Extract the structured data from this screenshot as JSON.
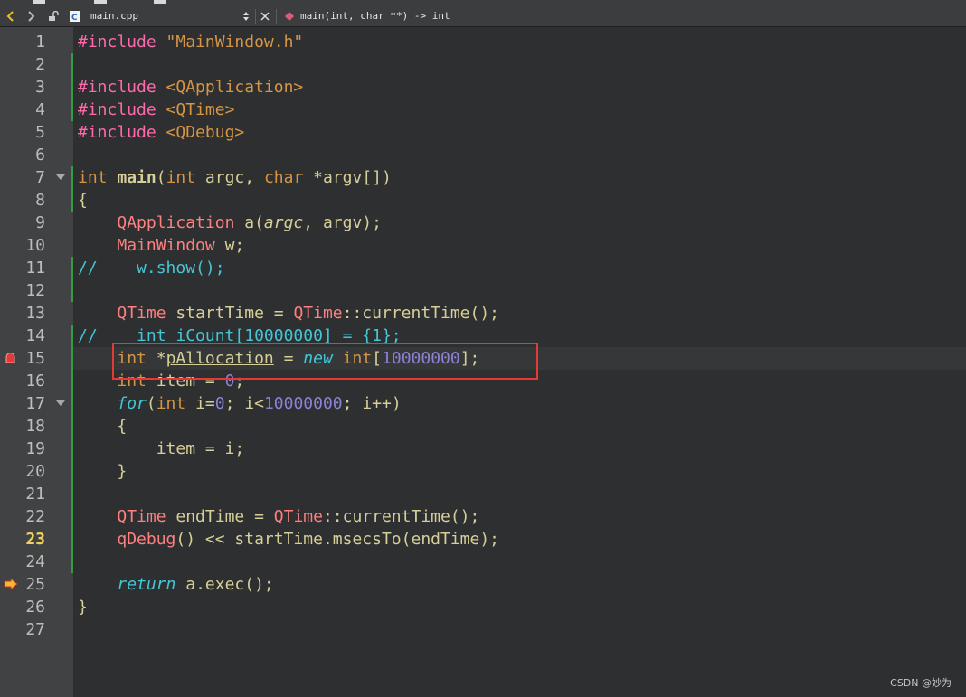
{
  "toolbar": {
    "filename": "main.cpp",
    "function": "main(int, char **) -> int"
  },
  "editor": {
    "current_line": 23,
    "breakpoint_line": 15,
    "execution_line": 25,
    "line_numbers": [
      "1",
      "2",
      "3",
      "4",
      "5",
      "6",
      "7",
      "8",
      "9",
      "10",
      "11",
      "12",
      "13",
      "14",
      "15",
      "16",
      "17",
      "18",
      "19",
      "20",
      "21",
      "22",
      "23",
      "24",
      "25",
      "26",
      "27"
    ]
  },
  "watermark": "CSDN @妙为",
  "colors": {
    "background": "#2e2f30",
    "gutter": "#404244",
    "highlight_box": "#e53935",
    "keyword": "#45c6d6",
    "preprocessor": "#ff6aad",
    "type": "#d69545",
    "number": "#8a82d6"
  }
}
